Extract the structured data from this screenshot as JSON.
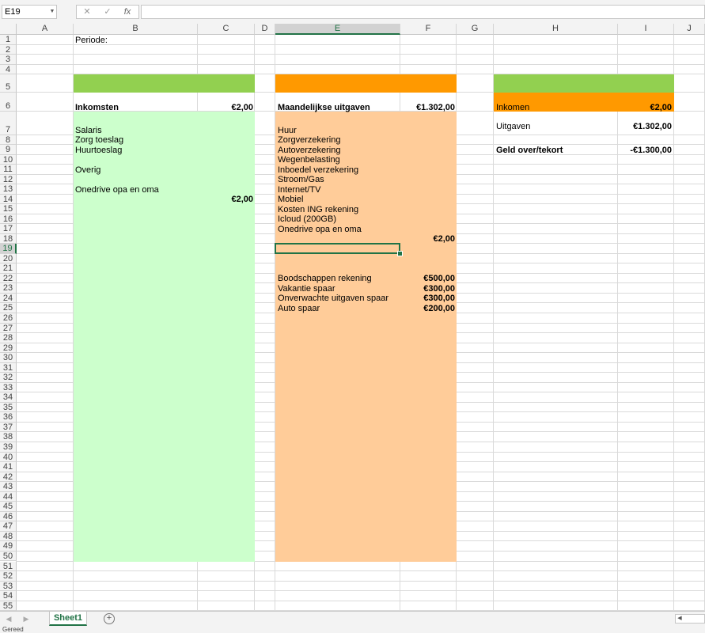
{
  "formula_bar": {
    "name_box": "E19",
    "cancel_icon": "✕",
    "enter_icon": "✓",
    "fx_label": "fx",
    "formula": ""
  },
  "columns": [
    "A",
    "B",
    "C",
    "D",
    "E",
    "F",
    "G",
    "H",
    "I",
    "J"
  ],
  "selected_column": "E",
  "selected_row": 19,
  "row_count": 56,
  "fills": {
    "green_header": "#92d050",
    "green_area": "#ccffcc",
    "orange_header": "#ff9900",
    "orange_area": "#ffcc99",
    "accent": "#217346"
  },
  "cells": {
    "periode_label": "Periode:",
    "inkomsten_label": "Inkomsten",
    "inkomsten_total": "€2,00",
    "income_items": [
      "Salaris",
      "Zorg toeslag",
      "Huurtoeslag",
      "",
      "Overig",
      "",
      "Onedrive opa en oma"
    ],
    "income_onedrive_value": "€2,00",
    "uitgaven_label": "Maandelijkse uitgaven",
    "uitgaven_total": "€1.302,00",
    "expense_items": [
      "Huur",
      "Zorgverzekering",
      "Autoverzekering",
      "Wegenbelasting",
      "Inboedel verzekering",
      "Stroom/Gas",
      "Internet/TV",
      "Mobiel",
      "Kosten ING rekening",
      "Icloud (200GB)",
      "Onedrive opa en oma"
    ],
    "expense_onedrive_value": "€2,00",
    "savings_items": [
      {
        "label": "Boodschappen rekening",
        "value": "€500,00"
      },
      {
        "label": "Vakantie spaar",
        "value": "€300,00"
      },
      {
        "label": "Onverwachte uitgaven spaar",
        "value": "€300,00"
      },
      {
        "label": "Auto spaar",
        "value": "€200,00"
      }
    ],
    "summary_inkomen_label": "Inkomen",
    "summary_inkomen_value": "€2,00",
    "summary_uitgaven_label": "Uitgaven",
    "summary_uitgaven_value": "€1.302,00",
    "summary_geld_label": "Geld over/tekort",
    "summary_geld_value": "-€1.300,00"
  },
  "sheet_tabs": [
    "Sheet1"
  ],
  "status": "Gereed"
}
